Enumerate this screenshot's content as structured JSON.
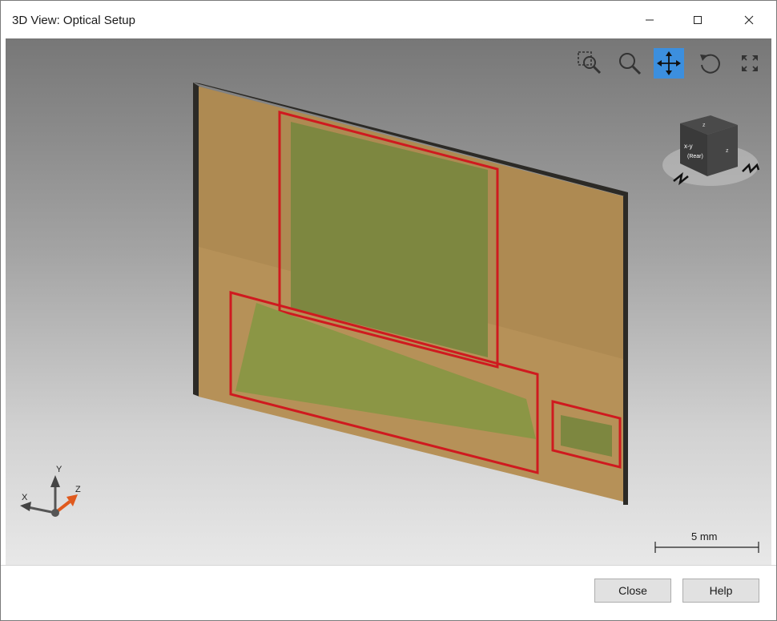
{
  "window": {
    "title": "3D View: Optical Setup",
    "controls": {
      "minimize": "–",
      "maximize": "☐",
      "close": "✕"
    }
  },
  "toolbar": {
    "tools": [
      {
        "name": "zoom-window",
        "icon": "zoom-window-icon"
      },
      {
        "name": "zoom",
        "icon": "magnifier-icon"
      },
      {
        "name": "pan",
        "icon": "move-arrows-icon",
        "active": true
      },
      {
        "name": "rotate",
        "icon": "rotate-icon"
      },
      {
        "name": "fit-all",
        "icon": "expand-arrows-icon"
      }
    ],
    "active_color": "#3c8fde"
  },
  "view_cube": {
    "face_label_line1": "x-y",
    "face_label_line2": "(Rear)",
    "top_label": "z",
    "side_label": "z"
  },
  "axes": {
    "x": "X",
    "y": "Y",
    "z": "Z"
  },
  "scale_bar": {
    "label": "5 mm"
  },
  "scene": {
    "substrate_color": "#b8955a",
    "region_fill": "#7e8a3f",
    "outline_color": "#d0141c"
  },
  "footer": {
    "close_label": "Close",
    "help_label": "Help"
  }
}
